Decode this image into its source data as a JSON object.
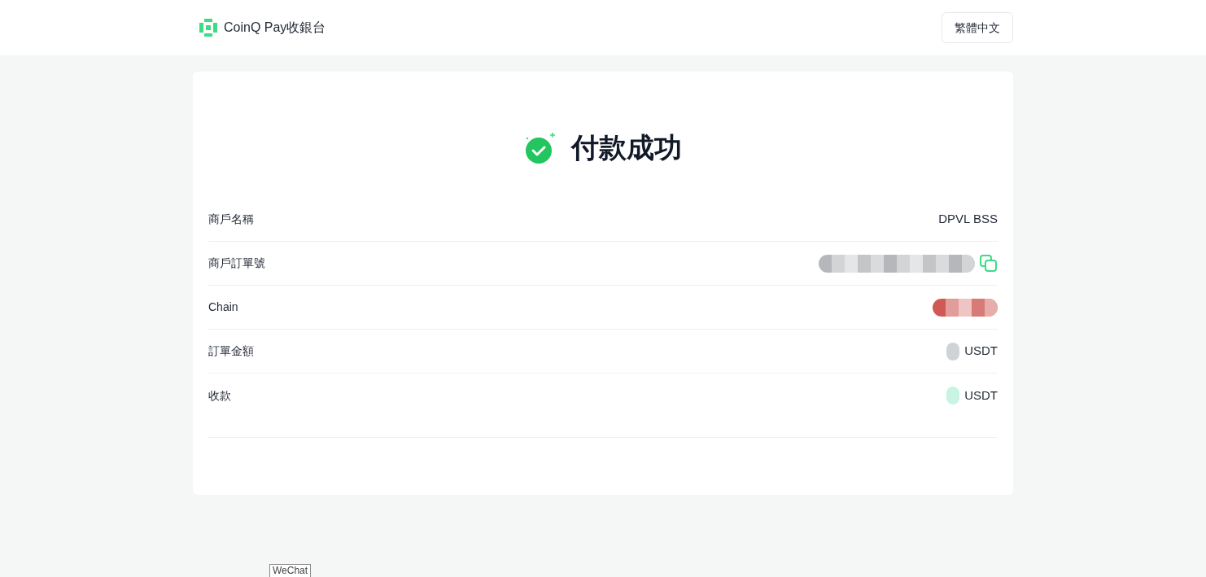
{
  "header": {
    "brand": "CoinQ Pay收銀台",
    "language_button": "繁體中文"
  },
  "status": {
    "title": "付款成功"
  },
  "rows": [
    {
      "label": "商戶名稱",
      "value": {
        "kind": "text",
        "text": "DPVL BSS"
      },
      "copyable": false
    },
    {
      "label": "商戶訂單號",
      "value": {
        "kind": "longblur",
        "color": "#b5b7ba"
      },
      "copyable": true
    },
    {
      "label": "Chain",
      "value": {
        "kind": "blur",
        "color": "#cf5a55"
      },
      "copyable": false
    },
    {
      "label": "訂單金額",
      "value": {
        "kind": "dot",
        "color": "#cfd3d7",
        "suffix": "USDT"
      },
      "copyable": false
    },
    {
      "label": "收款",
      "value": {
        "kind": "dot",
        "color": "#c9f3e2",
        "suffix": "USDT"
      },
      "copyable": false
    }
  ],
  "tooltip": "WeChat"
}
